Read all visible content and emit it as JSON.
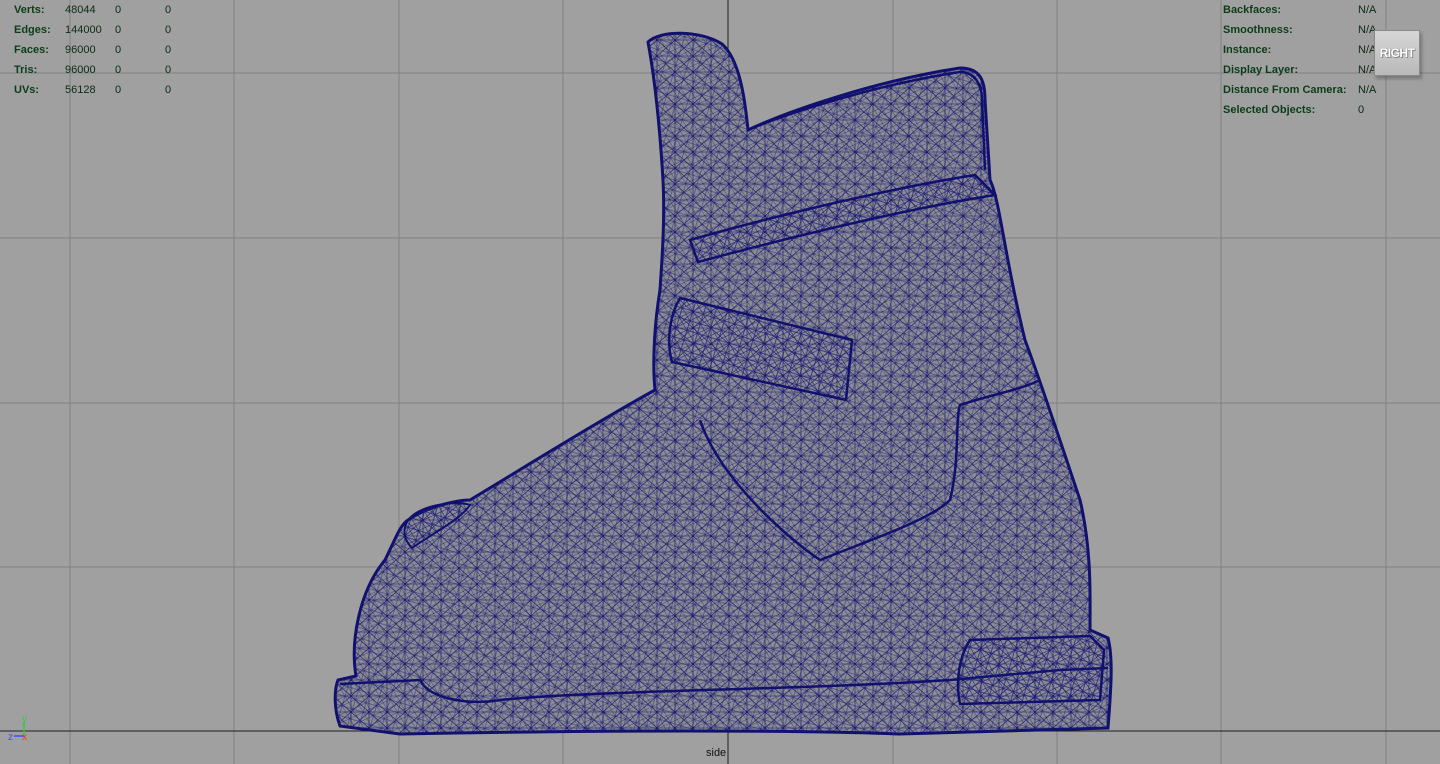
{
  "viewport": {
    "camera_name": "side",
    "view_cube_label": "RIGHT"
  },
  "hud_left": [
    {
      "label": "Verts:",
      "v1": "48044",
      "v2": "0",
      "v3": "0"
    },
    {
      "label": "Edges:",
      "v1": "144000",
      "v2": "0",
      "v3": "0"
    },
    {
      "label": "Faces:",
      "v1": "96000",
      "v2": "0",
      "v3": "0"
    },
    {
      "label": "Tris:",
      "v1": "96000",
      "v2": "0",
      "v3": "0"
    },
    {
      "label": "UVs:",
      "v1": "56128",
      "v2": "0",
      "v3": "0"
    }
  ],
  "hud_right": [
    {
      "label": "Backfaces:",
      "value": "N/A"
    },
    {
      "label": "Smoothness:",
      "value": "N/A"
    },
    {
      "label": "Instance:",
      "value": "N/A"
    },
    {
      "label": "Display Layer:",
      "value": "N/A"
    },
    {
      "label": "Distance From Camera:",
      "value": "N/A"
    },
    {
      "label": "Selected Objects:",
      "value": "0"
    }
  ],
  "axis": {
    "y_label": "y",
    "z_label": "z",
    "x_label": "x"
  },
  "colors": {
    "background": "#a0a0a0",
    "grid": "#7f7f7f",
    "grid_axis": "#202020",
    "wireframe": "#10106e",
    "mesh_fill": "#8a8a8f",
    "hud_text": "#0b3d1a"
  }
}
